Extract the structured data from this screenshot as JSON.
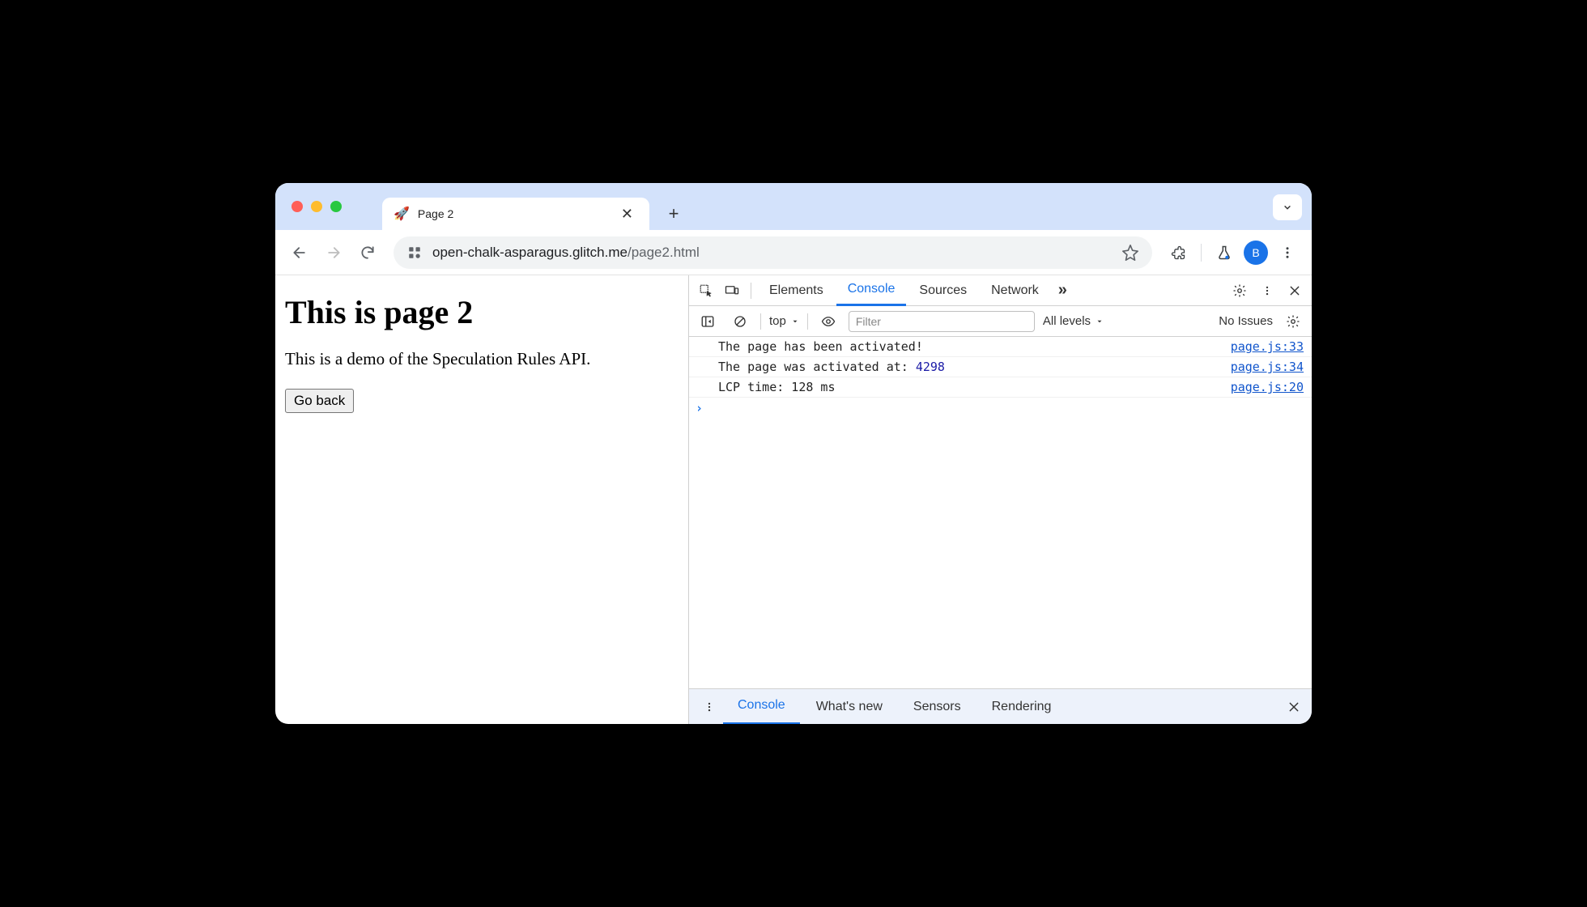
{
  "chrome": {
    "tab_icon": "🚀",
    "tab_title": "Page 2",
    "url_host": "open-chalk-asparagus.glitch.me",
    "url_path": "/page2.html",
    "avatar_initial": "B"
  },
  "page": {
    "heading": "This is page 2",
    "description": "This is a demo of the Speculation Rules API.",
    "back_button": "Go back"
  },
  "devtools": {
    "tabs": {
      "elements": "Elements",
      "console": "Console",
      "sources": "Sources",
      "network": "Network"
    },
    "console_toolbar": {
      "context": "top",
      "filter_placeholder": "Filter",
      "levels": "All levels",
      "issues": "No Issues"
    },
    "logs": [
      {
        "text": "The page has been activated!",
        "num": "",
        "src": "page.js:33"
      },
      {
        "text": "The page was activated at: ",
        "num": "4298",
        "src": "page.js:34"
      },
      {
        "text": "LCP time: 128 ms",
        "num": "",
        "src": "page.js:20"
      }
    ],
    "drawer": {
      "console": "Console",
      "whatsnew": "What's new",
      "sensors": "Sensors",
      "rendering": "Rendering"
    }
  }
}
